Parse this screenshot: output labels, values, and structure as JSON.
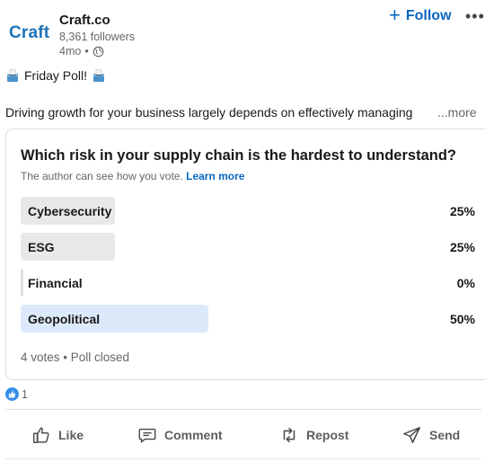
{
  "header": {
    "logo_text": "Craft",
    "company_name": "Craft.co",
    "followers": "8,361 followers",
    "time": "4mo",
    "separator": "•",
    "follow_label": "Follow",
    "follow_plus": "+",
    "more_label": "•••"
  },
  "post": {
    "headline": "Friday Poll!",
    "body": "Driving growth for your business largely depends on effectively managing",
    "more": "...more"
  },
  "poll": {
    "question": "Which risk in your supply chain is the hardest to understand?",
    "note": "The author can see how you vote.",
    "learn_more": "Learn more",
    "options": [
      {
        "label": "Cybersecurity",
        "percent_label": "25%",
        "percent": 25,
        "selected": false
      },
      {
        "label": "ESG",
        "percent_label": "25%",
        "percent": 25,
        "selected": false
      },
      {
        "label": "Financial",
        "percent_label": "0%",
        "percent": 0,
        "selected": false
      },
      {
        "label": "Geopolitical",
        "percent_label": "50%",
        "percent": 50,
        "selected": true
      }
    ],
    "status": "4 votes • Poll closed"
  },
  "reactions": {
    "count": "1"
  },
  "actions": {
    "like": "Like",
    "comment": "Comment",
    "repost": "Repost",
    "send": "Send"
  },
  "colors": {
    "accent": "#0a66c2",
    "logo": "#1d73b8",
    "bar": "#e8e8e8",
    "bar_selected": "#dce9fa"
  }
}
